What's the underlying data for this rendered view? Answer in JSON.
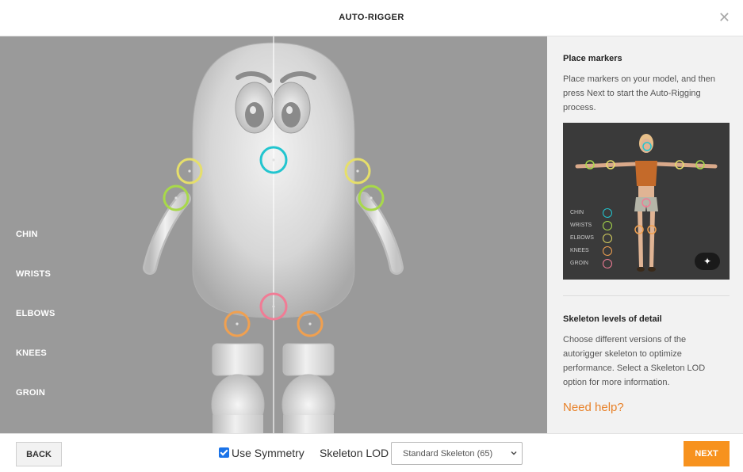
{
  "header": {
    "title": "AUTO-RIGGER",
    "close_icon": "close-icon"
  },
  "viewport": {
    "joint_labels": [
      "CHIN",
      "WRISTS",
      "ELBOWS",
      "KNEES",
      "GROIN"
    ],
    "marker_colors": {
      "chin": "#22c5cf",
      "wrists": "#e6df6a",
      "elbows": "#a8d94a",
      "knees": "#f0a050",
      "groin": "#f07c95"
    }
  },
  "sidebar": {
    "markers_title": "Place markers",
    "markers_text": "Place markers on your model, and then press Next to start the Auto-Rigging process.",
    "legend": [
      "CHIN",
      "WRISTS",
      "ELBOWS",
      "KNEES",
      "GROIN"
    ],
    "lod_title": "Skeleton levels of detail",
    "lod_text": "Choose different versions of the autorigger skeleton to optimize performance. Select a Skeleton LOD option for more information.",
    "help_link": "Need help?",
    "magic_icon": "magic-wand-icon"
  },
  "footer": {
    "back_label": "BACK",
    "symmetry_label": "Use Symmetry",
    "symmetry_checked": true,
    "lod_label": "Skeleton LOD",
    "lod_value": "Standard Skeleton (65)",
    "next_label": "NEXT"
  },
  "colors": {
    "accent": "#f7921e",
    "help_link": "#e8822a",
    "viewport_bg": "#9a9a9a",
    "sidebar_bg": "#f2f2f2"
  }
}
